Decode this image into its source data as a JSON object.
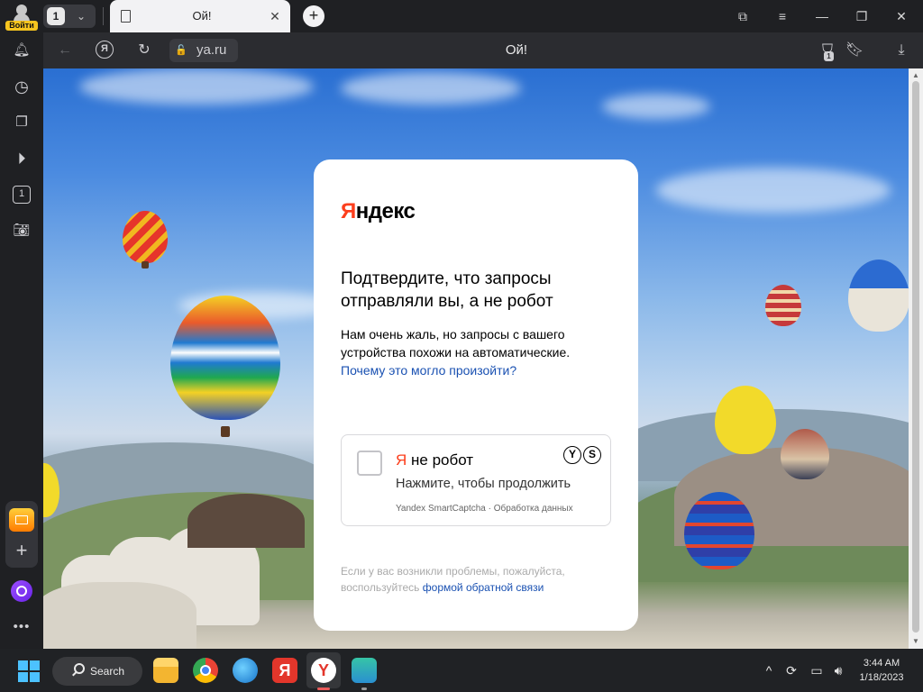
{
  "browser": {
    "profile_login_label": "Войти",
    "tab_count": "1",
    "tab": {
      "title": "Ой!",
      "close": "✕"
    },
    "new_tab": "+",
    "window": {
      "tabs_icon": "⧉",
      "menu_icon": "≡",
      "minimize": "—",
      "restore": "❐",
      "close": "✕"
    },
    "toolbar": {
      "back": "←",
      "yandex_icon_letter": "Я",
      "reload": "↻",
      "url": "ya.ru",
      "page_title": "Ой!",
      "protect_count": "1",
      "download": "⤓"
    },
    "sidebar": {
      "tabs_count": "1"
    }
  },
  "captcha": {
    "logo_first_letter": "Я",
    "logo_rest": "ндекс",
    "heading": "Подтвердите, что запросы отправляли вы, а не робот",
    "desc_text": "Нам очень жаль, но запросы с вашего устройства похожи на автоматические.",
    "desc_link": "Почему это могло произойти?",
    "checkbox_label_ya": "Я",
    "checkbox_label_rest": " не робот",
    "checkbox_hint": "Нажмите, чтобы продолжить",
    "logo_letters": [
      "Y",
      "S"
    ],
    "footer_brand": "Yandex SmartCaptcha",
    "footer_sep": " · ",
    "footer_link": "Обработка данных",
    "help_text": "Если у вас возникли проблемы, пожалуйста, воспользуйтесь",
    "help_link": "формой обратной связи"
  },
  "taskbar": {
    "search_label": "Search",
    "clock_time": "3:44 AM",
    "clock_date": "1/18/2023",
    "tray_chevron": "^"
  },
  "colors": {
    "yandex_red": "#fc3f1d",
    "link_blue": "#1a51b2",
    "card_bg": "#ffffff",
    "browser_dark": "#1f2023",
    "toolbar_dark": "#2b2c30"
  }
}
